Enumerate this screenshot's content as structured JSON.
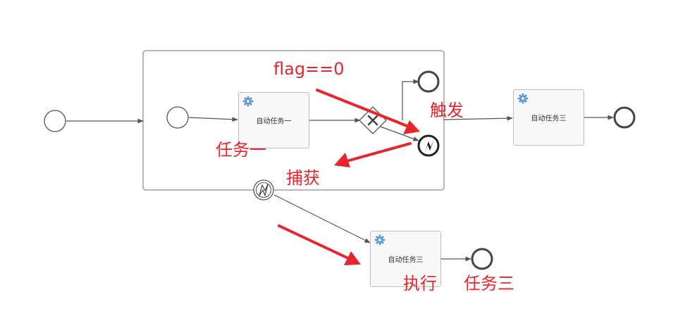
{
  "tasks": {
    "subprocess_task_1": "自动任务一",
    "task_3_top": "自动任务三",
    "task_3_bottom": "自动任务三"
  },
  "annotations": {
    "condition": "flag==0",
    "trigger": "触发",
    "task_one": "任务一",
    "capture": "捕获",
    "execute": "执行",
    "task_three": "任务三"
  },
  "colors": {
    "annotation_red": "#e8242c",
    "gear_blue": "#5b9bd5",
    "line_gray": "#555555"
  }
}
